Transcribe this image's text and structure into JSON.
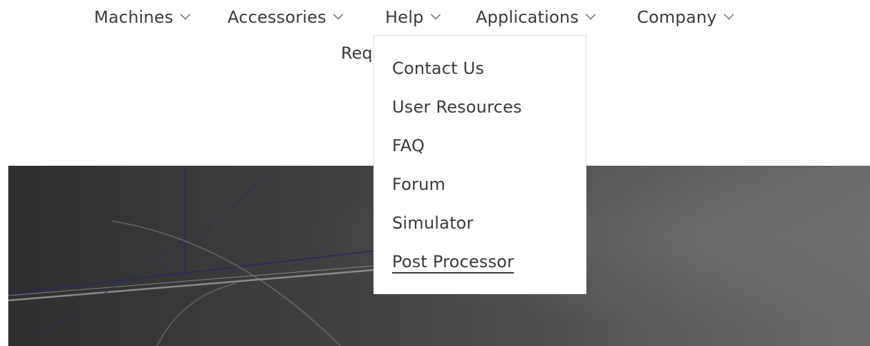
{
  "nav": {
    "items": [
      {
        "label": "Machines"
      },
      {
        "label": "Accessories"
      },
      {
        "label": "Help"
      },
      {
        "label": "Applications"
      },
      {
        "label": "Company"
      }
    ],
    "second_row_partial": "Req"
  },
  "help_menu": {
    "items": [
      {
        "label": "Contact Us"
      },
      {
        "label": "User Resources"
      },
      {
        "label": "FAQ"
      },
      {
        "label": "Forum"
      },
      {
        "label": "Simulator"
      },
      {
        "label": "Post Processor"
      }
    ]
  },
  "colors": {
    "text": "#3a3a3a",
    "hero_dark": "#2f2f2f",
    "hero_light": "#6a6a6a",
    "dropdown_border": "#e2e2e2"
  }
}
